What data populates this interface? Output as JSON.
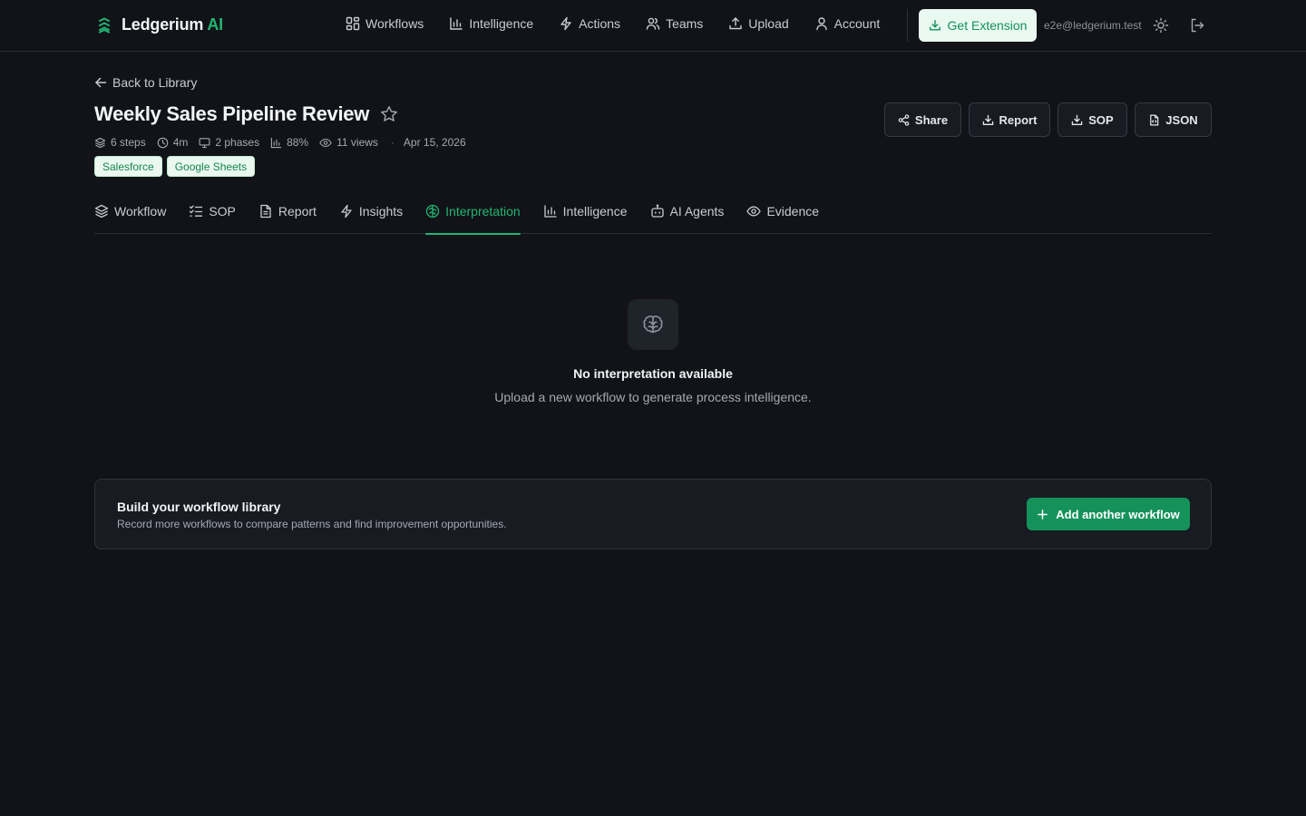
{
  "brand": {
    "name": "Ledgerium",
    "accent": "AI"
  },
  "nav": [
    {
      "label": "Workflows",
      "icon": "grid-icon"
    },
    {
      "label": "Intelligence",
      "icon": "bar-chart-icon"
    },
    {
      "label": "Actions",
      "icon": "lightning-icon"
    },
    {
      "label": "Teams",
      "icon": "users-icon"
    },
    {
      "label": "Upload",
      "icon": "upload-icon"
    },
    {
      "label": "Account",
      "icon": "user-icon"
    }
  ],
  "header_actions": {
    "get_extension": "Get Extension",
    "email": "e2e@ledgerium.test"
  },
  "page": {
    "back_label": "Back to Library",
    "title": "Weekly Sales Pipeline Review",
    "meta": {
      "steps": "6 steps",
      "duration": "4m",
      "phases": "2 phases",
      "score": "88%",
      "views": "11 views",
      "separator": "·",
      "date": "Apr 15, 2026"
    },
    "tags": [
      "Salesforce",
      "Google Sheets"
    ],
    "actions": {
      "share": "Share",
      "report": "Report",
      "sop": "SOP",
      "json": "JSON"
    }
  },
  "tabs": [
    {
      "label": "Workflow",
      "icon": "layers-icon",
      "active": false
    },
    {
      "label": "SOP",
      "icon": "checklist-icon",
      "active": false
    },
    {
      "label": "Report",
      "icon": "document-icon",
      "active": false
    },
    {
      "label": "Insights",
      "icon": "lightning-icon",
      "active": false
    },
    {
      "label": "Interpretation",
      "icon": "brain-icon",
      "active": true
    },
    {
      "label": "Intelligence",
      "icon": "bar-chart-icon",
      "active": false
    },
    {
      "label": "AI Agents",
      "icon": "bot-icon",
      "active": false
    },
    {
      "label": "Evidence",
      "icon": "eye-icon",
      "active": false
    }
  ],
  "empty_state": {
    "title": "No interpretation available",
    "subtitle": "Upload a new workflow to generate process intelligence."
  },
  "cta": {
    "title": "Build your workflow library",
    "subtitle": "Record more workflows to compare patterns and find improvement opportunities.",
    "button": "Add another workflow"
  },
  "colors": {
    "accent": "#22b573",
    "background": "#111318",
    "card": "#181b21",
    "button_primary": "#14925a"
  }
}
